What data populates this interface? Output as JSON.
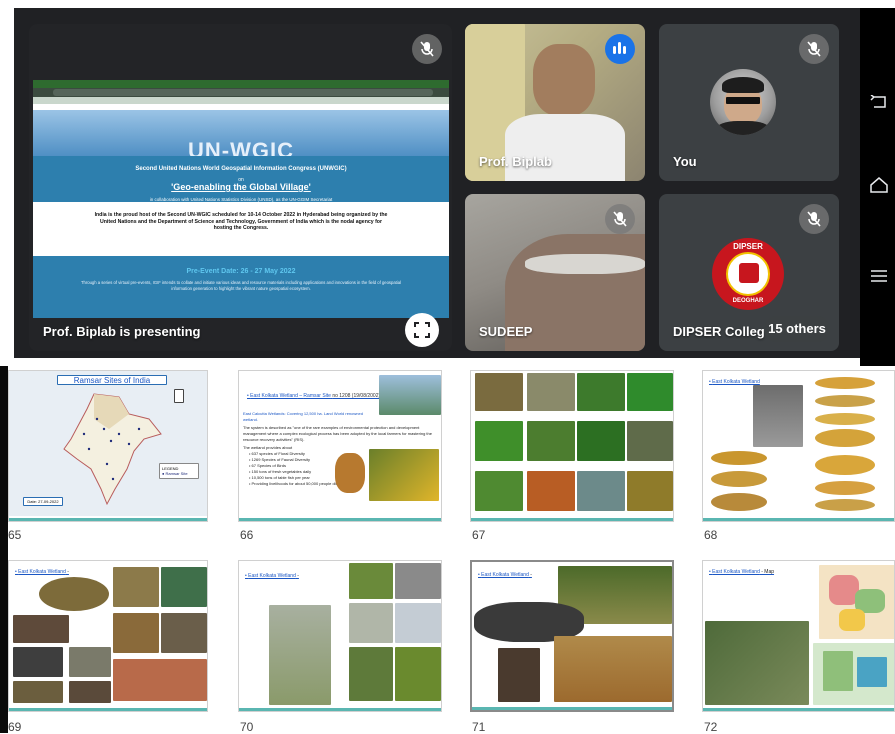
{
  "meet": {
    "presenter_banner": "Prof. Biplab is presenting",
    "tiles": [
      {
        "name": "Prof. Biplab",
        "status": "speaking"
      },
      {
        "name": "You",
        "status": "muted"
      },
      {
        "name": "SUDEEP",
        "status": "muted"
      },
      {
        "name": "DIPSER Colleg",
        "status": "muted"
      }
    ],
    "others_label": "15 others",
    "presented_slide": {
      "title": "UN-WGIC",
      "line1": "Second United Nations World Geospatial Information Congress (UNWGIC)",
      "line2": "on",
      "theme": "'Geo-enabling the Global Village'",
      "collab": "in collaboration with United Nations Statistics Division (UNSD), as the UN-GGIM Secretariat",
      "india_text": "India is the proud host of the Second UN-WGIC scheduled for 10-14 October 2022 in Hyderabad being organized by the United Nations and the Department of Science and Technology, Government of India which is the nodal agency for hosting the Congress.",
      "pre_event": "Pre-Event Date: 26 - 27 May 2022",
      "pre_body": "Through a series of virtual pre-events, IGIF intends to collate and initiate various ideas and resource materials including applications and innovations in the field of geospatial information generation to highlight the vibrant nature geospatial ecosystem."
    },
    "dipser_logo": {
      "top": "DIPSER",
      "bottom": "DEOGHAR"
    }
  },
  "sidebar_icons": [
    "back-icon",
    "home-icon",
    "menu-icon"
  ],
  "slides": [
    {
      "num": "65",
      "title": "Ramsar Sites of India",
      "legend": "LEGEND",
      "legend_item": "Ramsar Site",
      "date": "Date: 27-09-2022"
    },
    {
      "num": "66",
      "link": "East Kolkata Wetland",
      "link2": "Ramsar Site",
      "title_rest": "no 1208 (19/08/2002)",
      "sub": "East Calcutta Wetlands: Covering 12,500 ha. Land World renowned wetland.",
      "body": "The system is described as \"one of the rare examples of environmental protection and development management where a complex ecological process has been adopted by the local farmers for mastering the resource recovery activities\" (RIS).",
      "provides": "The wetland provides about",
      "bullets": [
        "637 species of Floral Diversity",
        "1269 Species of Faunal Diversity",
        "67 Species of Birds",
        "150 tons of fresh vegetables daily",
        "10,500 tons of table fish per year",
        "Providing livelihoods for about 50,000 people directly and"
      ]
    },
    {
      "num": "67"
    },
    {
      "num": "68",
      "link": "East Kolkata Wetland"
    },
    {
      "num": "69",
      "link": "East Kolkata Wetland",
      "link_suffix": " -"
    },
    {
      "num": "70",
      "link": "East Kolkata Wetland",
      "link_suffix": " -"
    },
    {
      "num": "71",
      "link": "East Kolkata Wetland",
      "link_suffix": " -"
    },
    {
      "num": "72",
      "link": "East Kolkata Wetland",
      "link_suffix": " - Map"
    }
  ],
  "colors": {
    "meet_bg": "#202124",
    "tile_bg": "#3c4043",
    "speaking": "#1a73e8",
    "slide_blue": "#2d7fae",
    "thumb_footer": "#5ab6b1"
  }
}
